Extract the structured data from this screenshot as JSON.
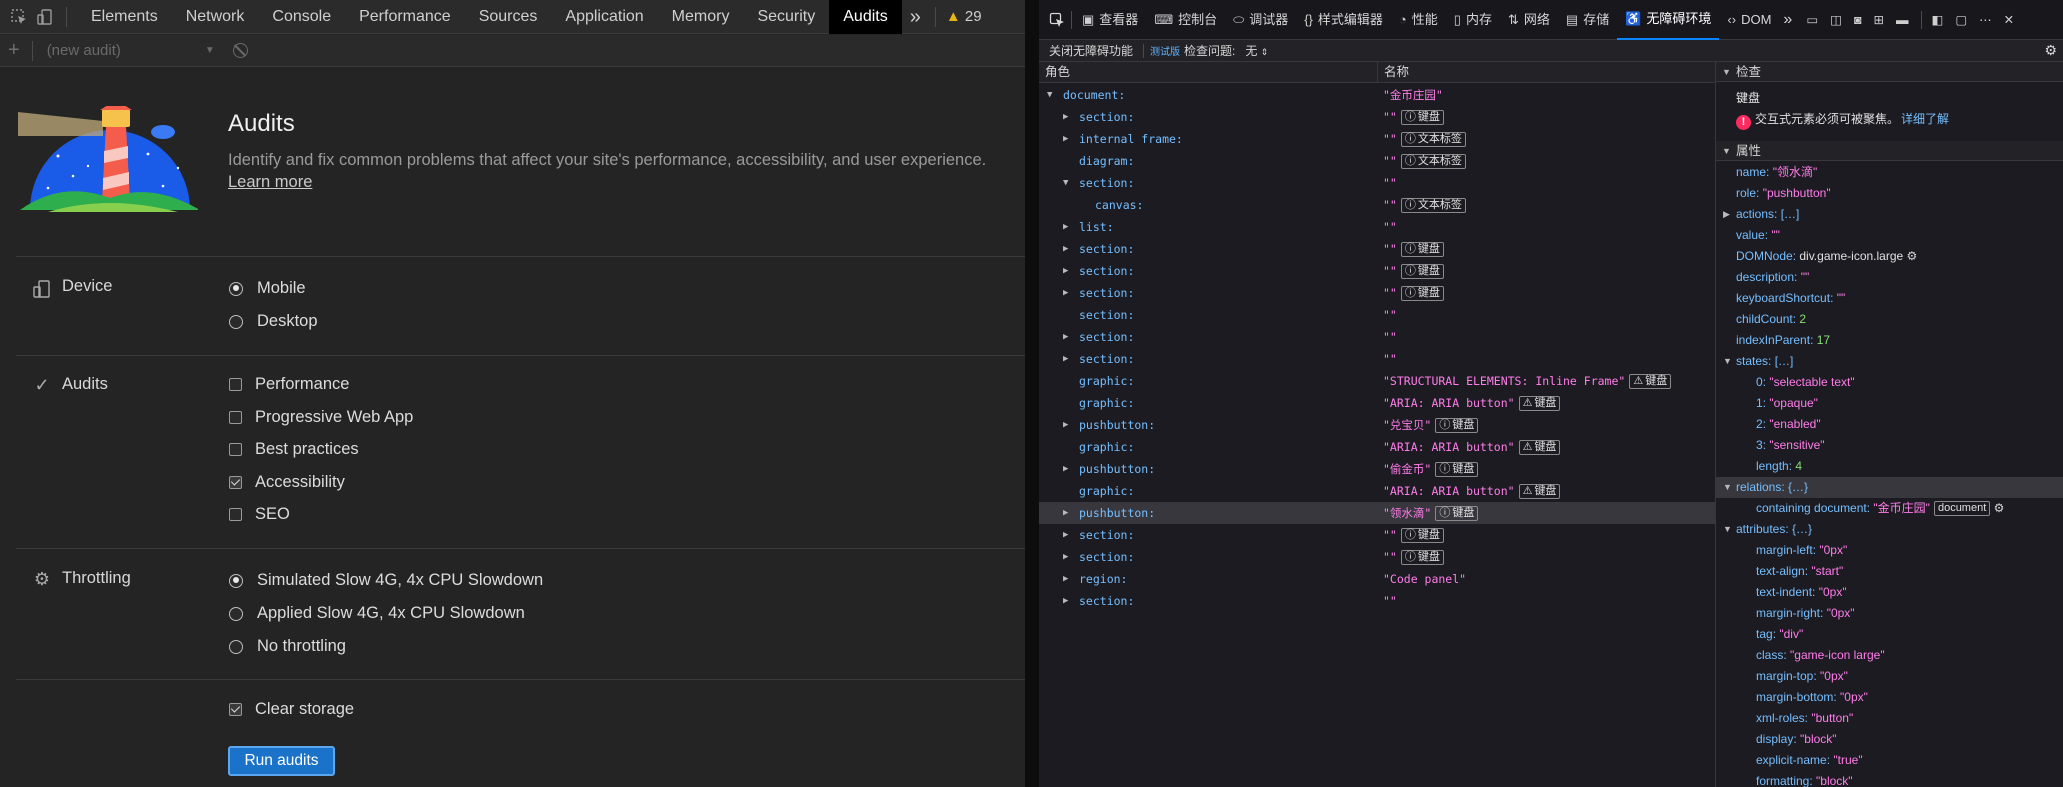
{
  "left": {
    "tabs": [
      "Elements",
      "Network",
      "Console",
      "Performance",
      "Sources",
      "Application",
      "Memory",
      "Security",
      "Audits"
    ],
    "more": "»",
    "warnings": "29",
    "audit_select": "(new audit)",
    "title": "Audits",
    "description": "Identify and fix common problems that affect your site's performance, accessibility, and user experience.",
    "learn_more": "Learn more",
    "device": {
      "label": "Device",
      "options": [
        "Mobile",
        "Desktop"
      ],
      "selected": "Mobile"
    },
    "audits": {
      "label": "Audits",
      "options": [
        {
          "label": "Performance",
          "checked": false
        },
        {
          "label": "Progressive Web App",
          "checked": false
        },
        {
          "label": "Best practices",
          "checked": false
        },
        {
          "label": "Accessibility",
          "checked": true
        },
        {
          "label": "SEO",
          "checked": false
        }
      ]
    },
    "throttling": {
      "label": "Throttling",
      "options": [
        "Simulated Slow 4G, 4x CPU Slowdown",
        "Applied Slow 4G, 4x CPU Slowdown",
        "No throttling"
      ],
      "selected": "Simulated Slow 4G, 4x CPU Slowdown"
    },
    "clear_storage": {
      "label": "Clear storage",
      "checked": true
    },
    "run_button": "Run audits"
  },
  "right": {
    "tabs": [
      {
        "icon": "inspector-icon",
        "label": "查看器"
      },
      {
        "icon": "console-icon",
        "label": "控制台"
      },
      {
        "icon": "debugger-icon",
        "label": "调试器"
      },
      {
        "icon": "style-editor-icon",
        "label": "样式编辑器"
      },
      {
        "icon": "performance-icon",
        "label": "性能"
      },
      {
        "icon": "memory-icon",
        "label": "内存"
      },
      {
        "icon": "network-icon",
        "label": "网络"
      },
      {
        "icon": "storage-icon",
        "label": "存储"
      },
      {
        "icon": "accessibility-icon",
        "label": "无障碍环境"
      },
      {
        "icon": "dom-icon",
        "label": "DOM"
      }
    ],
    "toolbar": {
      "disable_button": "关闭无障碍功能",
      "beta": "测试版",
      "check_label": "检查问题:",
      "check_value": "无"
    },
    "columns": {
      "role": "角色",
      "name": "名称"
    },
    "tree": [
      {
        "depth": 0,
        "twisty": "open",
        "role": "document:",
        "name": "\"金币庄园\"",
        "badges": []
      },
      {
        "depth": 1,
        "twisty": "closed",
        "role": "section:",
        "name": "\"\"",
        "badges": [
          {
            "icon": "info",
            "text": "键盘"
          }
        ]
      },
      {
        "depth": 1,
        "twisty": "closed",
        "role": "internal frame:",
        "name": "\"\"",
        "badges": [
          {
            "icon": "info",
            "text": "文本标签"
          }
        ]
      },
      {
        "depth": 1,
        "twisty": "none",
        "role": "diagram:",
        "name": "\"\"",
        "badges": [
          {
            "icon": "info",
            "text": "文本标签"
          }
        ]
      },
      {
        "depth": 1,
        "twisty": "open",
        "role": "section:",
        "name": "\"\"",
        "badges": []
      },
      {
        "depth": 2,
        "twisty": "none",
        "role": "canvas:",
        "name": "\"\"",
        "badges": [
          {
            "icon": "info",
            "text": "文本标签"
          }
        ]
      },
      {
        "depth": 1,
        "twisty": "closed",
        "role": "list:",
        "name": "\"\"",
        "badges": []
      },
      {
        "depth": 1,
        "twisty": "closed",
        "role": "section:",
        "name": "\"\"",
        "badges": [
          {
            "icon": "info",
            "text": "键盘"
          }
        ]
      },
      {
        "depth": 1,
        "twisty": "closed",
        "role": "section:",
        "name": "\"\"",
        "badges": [
          {
            "icon": "info",
            "text": "键盘"
          }
        ]
      },
      {
        "depth": 1,
        "twisty": "closed",
        "role": "section:",
        "name": "\"\"",
        "badges": [
          {
            "icon": "info",
            "text": "键盘"
          }
        ]
      },
      {
        "depth": 1,
        "twisty": "none",
        "role": "section:",
        "name": "\"\"",
        "badges": []
      },
      {
        "depth": 1,
        "twisty": "closed",
        "role": "section:",
        "name": "\"\"",
        "badges": []
      },
      {
        "depth": 1,
        "twisty": "closed",
        "role": "section:",
        "name": "\"\"",
        "badges": []
      },
      {
        "depth": 1,
        "twisty": "none",
        "role": "graphic:",
        "name": "\"STRUCTURAL ELEMENTS: Inline Frame\"",
        "badges": [
          {
            "icon": "warning",
            "text": "键盘"
          }
        ]
      },
      {
        "depth": 1,
        "twisty": "none",
        "role": "graphic:",
        "name": "\"ARIA: ARIA button\"",
        "badges": [
          {
            "icon": "warning",
            "text": "键盘"
          }
        ]
      },
      {
        "depth": 1,
        "twisty": "closed",
        "role": "pushbutton:",
        "name": "\"兑宝贝\"",
        "badges": [
          {
            "icon": "info",
            "text": "键盘"
          }
        ]
      },
      {
        "depth": 1,
        "twisty": "none",
        "role": "graphic:",
        "name": "\"ARIA: ARIA button\"",
        "badges": [
          {
            "icon": "warning",
            "text": "键盘"
          }
        ]
      },
      {
        "depth": 1,
        "twisty": "closed",
        "role": "pushbutton:",
        "name": "\"偷金币\"",
        "badges": [
          {
            "icon": "info",
            "text": "键盘"
          }
        ]
      },
      {
        "depth": 1,
        "twisty": "none",
        "role": "graphic:",
        "name": "\"ARIA: ARIA button\"",
        "badges": [
          {
            "icon": "warning",
            "text": "键盘"
          }
        ]
      },
      {
        "depth": 1,
        "twisty": "closed",
        "role": "pushbutton:",
        "name": "\"领水滴\"",
        "badges": [
          {
            "icon": "info",
            "text": "键盘"
          }
        ],
        "selected": true
      },
      {
        "depth": 1,
        "twisty": "closed",
        "role": "section:",
        "name": "\"\"",
        "badges": [
          {
            "icon": "info",
            "text": "键盘"
          }
        ]
      },
      {
        "depth": 1,
        "twisty": "closed",
        "role": "section:",
        "name": "\"\"",
        "badges": [
          {
            "icon": "info",
            "text": "键盘"
          }
        ]
      },
      {
        "depth": 1,
        "twisty": "closed",
        "role": "region:",
        "name": "\"Code panel\"",
        "badges": []
      },
      {
        "depth": 1,
        "twisty": "closed",
        "role": "section:",
        "name": "\"\"",
        "badges": []
      }
    ],
    "sidebar": {
      "check_header": "检查",
      "check_title": "键盘",
      "check_message": "交互式元素必须可被聚焦。",
      "check_link": "详细了解",
      "props_header": "属性",
      "props": [
        {
          "indent": 0,
          "twisty": "none",
          "key": "name",
          "value": "\"领水滴\"",
          "type": "s"
        },
        {
          "indent": 0,
          "twisty": "none",
          "key": "role",
          "value": "\"pushbutton\"",
          "type": "s"
        },
        {
          "indent": 0,
          "twisty": "closed",
          "key": "actions",
          "value": "[…]",
          "type": "k"
        },
        {
          "indent": 0,
          "twisty": "none",
          "key": "value",
          "value": "\"\"",
          "type": "s"
        },
        {
          "indent": 0,
          "twisty": "none",
          "key": "DOMNode",
          "value": "div.game-icon.large",
          "type": "k",
          "gear": true
        },
        {
          "indent": 0,
          "twisty": "none",
          "key": "description",
          "value": "\"\"",
          "type": "s"
        },
        {
          "indent": 0,
          "twisty": "none",
          "key": "keyboardShortcut",
          "value": "\"\"",
          "type": "s"
        },
        {
          "indent": 0,
          "twisty": "none",
          "key": "childCount",
          "value": "2",
          "type": "n"
        },
        {
          "indent": 0,
          "twisty": "none",
          "key": "indexInParent",
          "value": "17",
          "type": "n"
        },
        {
          "indent": 0,
          "twisty": "open",
          "key": "states",
          "value": "[…]",
          "type": "k"
        },
        {
          "indent": 1,
          "twisty": "none",
          "key": "0",
          "value": "\"selectable text\"",
          "type": "s"
        },
        {
          "indent": 1,
          "twisty": "none",
          "key": "1",
          "value": "\"opaque\"",
          "type": "s"
        },
        {
          "indent": 1,
          "twisty": "none",
          "key": "2",
          "value": "\"enabled\"",
          "type": "s"
        },
        {
          "indent": 1,
          "twisty": "none",
          "key": "3",
          "value": "\"sensitive\"",
          "type": "s"
        },
        {
          "indent": 1,
          "twisty": "none",
          "key": "length",
          "value": "4",
          "type": "n"
        },
        {
          "indent": 0,
          "twisty": "open",
          "key": "relations",
          "value": "{…}",
          "type": "k",
          "selected": true
        },
        {
          "indent": 1,
          "twisty": "none",
          "key": "containing document",
          "value": "\"金币庄园\"",
          "type": "s",
          "badge": "document",
          "gear": true
        },
        {
          "indent": 0,
          "twisty": "open",
          "key": "attributes",
          "value": "{…}",
          "type": "k"
        },
        {
          "indent": 1,
          "twisty": "none",
          "key": "margin-left",
          "value": "\"0px\"",
          "type": "s"
        },
        {
          "indent": 1,
          "twisty": "none",
          "key": "text-align",
          "value": "\"start\"",
          "type": "s"
        },
        {
          "indent": 1,
          "twisty": "none",
          "key": "text-indent",
          "value": "\"0px\"",
          "type": "s"
        },
        {
          "indent": 1,
          "twisty": "none",
          "key": "margin-right",
          "value": "\"0px\"",
          "type": "s"
        },
        {
          "indent": 1,
          "twisty": "none",
          "key": "tag",
          "value": "\"div\"",
          "type": "s"
        },
        {
          "indent": 1,
          "twisty": "none",
          "key": "class",
          "value": "\"game-icon large\"",
          "type": "s"
        },
        {
          "indent": 1,
          "twisty": "none",
          "key": "margin-top",
          "value": "\"0px\"",
          "type": "s"
        },
        {
          "indent": 1,
          "twisty": "none",
          "key": "margin-bottom",
          "value": "\"0px\"",
          "type": "s"
        },
        {
          "indent": 1,
          "twisty": "none",
          "key": "xml-roles",
          "value": "\"button\"",
          "type": "s"
        },
        {
          "indent": 1,
          "twisty": "none",
          "key": "display",
          "value": "\"block\"",
          "type": "s"
        },
        {
          "indent": 1,
          "twisty": "none",
          "key": "explicit-name",
          "value": "\"true\"",
          "type": "s"
        },
        {
          "indent": 1,
          "twisty": "none",
          "key": "formatting",
          "value": "\"block\"",
          "type": "s"
        }
      ]
    }
  }
}
